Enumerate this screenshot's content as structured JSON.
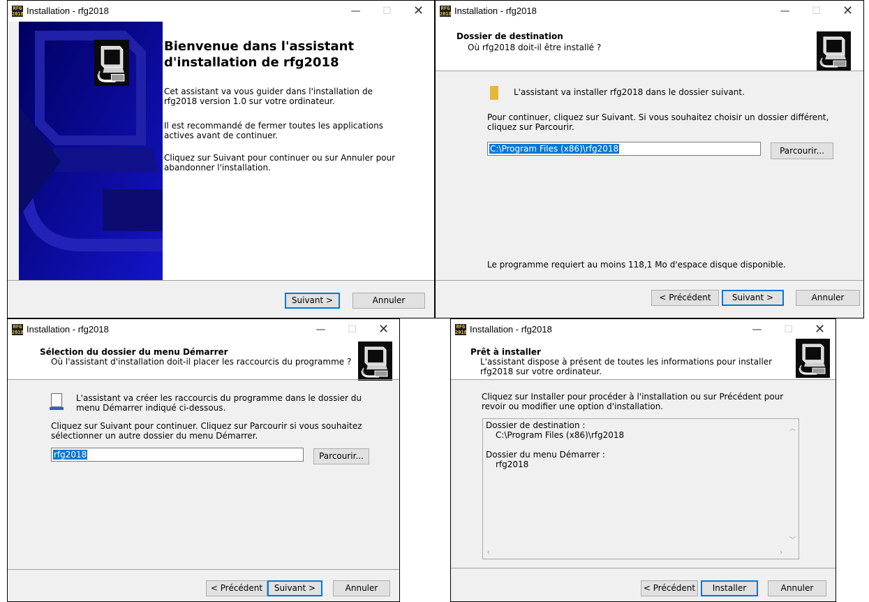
{
  "app_title": "Installation - rfg2018",
  "app_icon_text": "RFG\n2018",
  "window_controls": {
    "minimize": "—",
    "maximize": "☐",
    "close": "✕"
  },
  "welcome": {
    "heading": "Bienvenue dans l'assistant d'installation de rfg2018",
    "para1": "Cet assistant va vous guider dans l'installation de rfg2018 version 1.0 sur votre ordinateur.",
    "para2": "Il est recommandé de fermer toutes les applications actives avant de continuer.",
    "para3": "Cliquez sur Suivant pour continuer ou sur Annuler pour abandonner l'installation.",
    "next_button": "Suivant >",
    "cancel_button": "Annuler"
  },
  "destination": {
    "title": "Dossier de destination",
    "subtitle": "Où rfg2018 doit-il être installé ?",
    "info": "L'assistant va installer rfg2018 dans le dossier suivant.",
    "instructions": "Pour continuer, cliquez sur Suivant. Si vous souhaitez choisir un dossier différent, cliquez sur Parcourir.",
    "path_value": "C:\\Program Files (x86)\\rfg2018",
    "browse_button": "Parcourir...",
    "space_note": "Le programme requiert au moins 118,1 Mo d'espace disque disponible.",
    "back_button": "< Précédent",
    "next_button": "Suivant >",
    "cancel_button": "Annuler"
  },
  "start_menu": {
    "title": "Sélection du dossier du menu Démarrer",
    "subtitle": "Où l'assistant d'installation doit-il placer les raccourcis du programme ?",
    "info": "L'assistant va créer les raccourcis du programme dans le dossier du menu Démarrer indiqué ci-dessous.",
    "instructions": "Cliquez sur Suivant pour continuer. Cliquez sur Parcourir si vous souhaitez sélectionner un autre dossier du menu Démarrer.",
    "folder_value": "rfg2018",
    "browse_button": "Parcourir...",
    "back_button": "< Précédent",
    "next_button": "Suivant >",
    "cancel_button": "Annuler"
  },
  "ready": {
    "title": "Prêt à installer",
    "subtitle": "L'assistant dispose à présent de toutes les informations pour installer rfg2018 sur votre ordinateur.",
    "instructions": "Cliquez sur Installer pour procéder à l'installation ou sur Précédent pour revoir ou modifier une option d'installation.",
    "summary_dest_label": "Dossier de destination :",
    "summary_dest_value": "C:\\Program Files (x86)\\rfg2018",
    "summary_menu_label": "Dossier du menu Démarrer :",
    "summary_menu_value": "rfg2018",
    "back_button": "< Précédent",
    "install_button": "Installer",
    "cancel_button": "Annuler"
  }
}
